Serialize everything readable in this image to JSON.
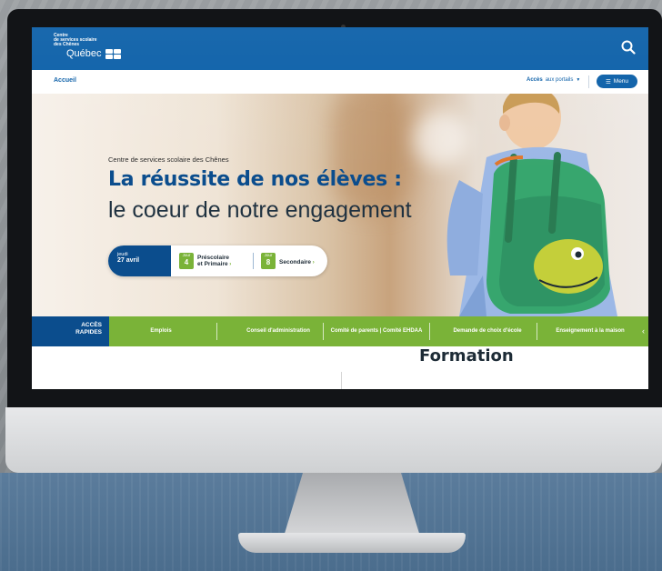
{
  "header": {
    "logo_line1": "Centre",
    "logo_line2": "de services scolaire",
    "logo_line3": "des Chênes",
    "logo_quebec": "Québec",
    "breadcrumb": "Accueil",
    "portals_label_bold": "Accès",
    "portals_label": "aux portails",
    "menu_label": "Menu"
  },
  "hero": {
    "subtitle": "Centre de services scolaire des Chênes",
    "title": "La réussite de nos élèves :",
    "title_line2": "le coeur de notre engagement",
    "day_of_week": "jeudi",
    "date": "27 avril",
    "schedule": [
      {
        "jour_label": "Jour",
        "jour_number": "4",
        "label_line1": "Préscolaire",
        "label_line2": "et Primaire"
      },
      {
        "jour_label": "Jour",
        "jour_number": "8",
        "label_line1": "Secondaire",
        "label_line2": ""
      }
    ]
  },
  "quick_access": {
    "title_line1": "ACCÈS",
    "title_line2": "RAPIDES",
    "items": [
      "Emplois",
      "Conseil d'administration",
      "Comité de parents | Comité EHDAA",
      "Demande de choix d'école",
      "Enseignement à la maison"
    ]
  },
  "section": {
    "heading": "Formation"
  },
  "colors": {
    "primary_blue": "#0b5fa8",
    "dark_blue": "#0b4d8d",
    "accent_green": "#7ab338"
  }
}
